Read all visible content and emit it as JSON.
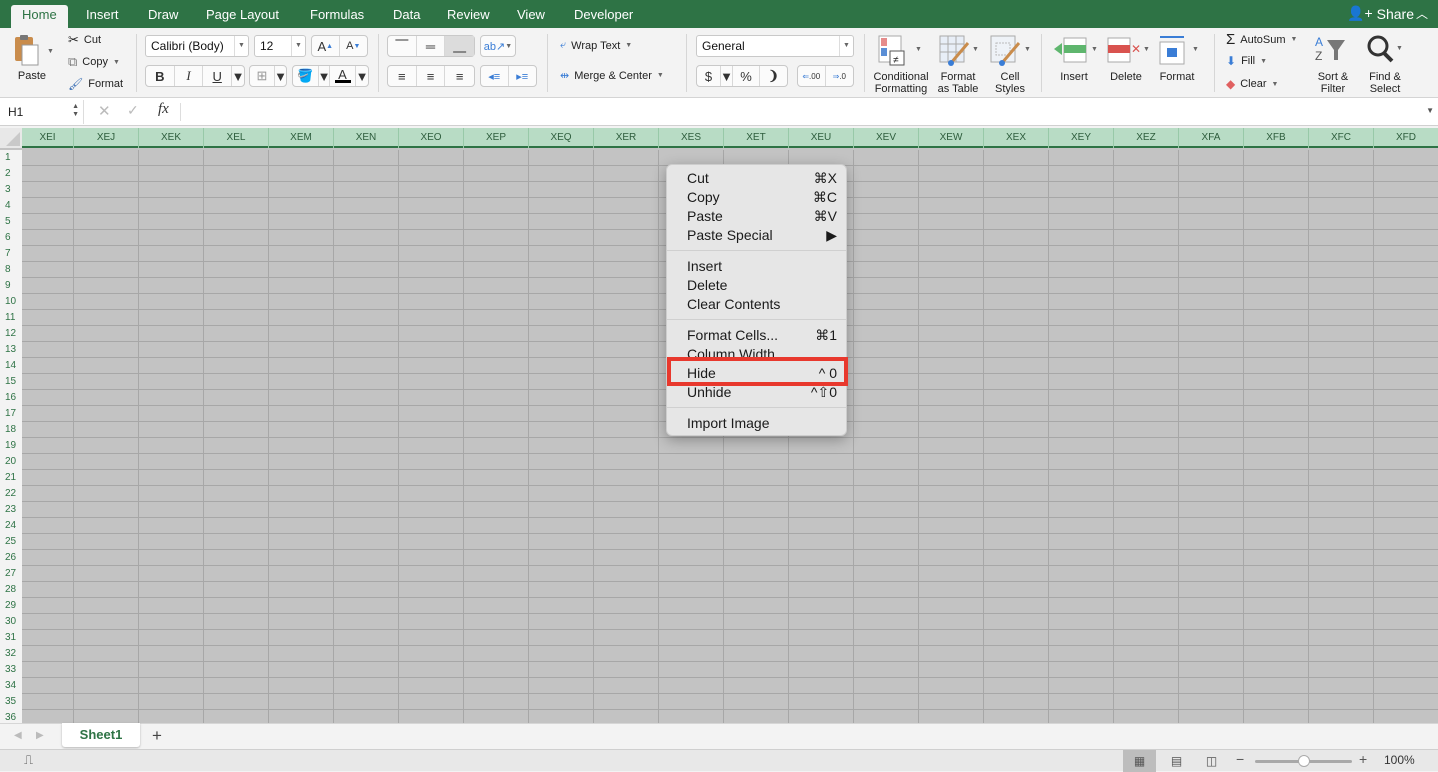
{
  "ribbon_tabs": [
    "Home",
    "Insert",
    "Draw",
    "Page Layout",
    "Formulas",
    "Data",
    "Review",
    "View",
    "Developer"
  ],
  "active_tab": "Home",
  "share_label": "Share",
  "clipboard": {
    "paste": "Paste",
    "cut": "Cut",
    "copy": "Copy",
    "format": "Format"
  },
  "font": {
    "name": "Calibri (Body)",
    "size": "12",
    "bold": "B",
    "italic": "I",
    "underline": "U"
  },
  "alignment": {
    "wrap_text": "Wrap Text",
    "merge_center": "Merge & Center"
  },
  "number": {
    "format": "General",
    "currency": "$",
    "percent": "%",
    "comma": "❩",
    "inc_decimal": ".00",
    "dec_decimal": ".0"
  },
  "styles": {
    "conditional": [
      "Conditional",
      "Formatting"
    ],
    "format_table": [
      "Format",
      "as Table"
    ],
    "cell_styles": [
      "Cell",
      "Styles"
    ]
  },
  "cells": {
    "insert": "Insert",
    "delete": "Delete",
    "format": "Format"
  },
  "editing": {
    "autosum": "AutoSum",
    "fill": "Fill",
    "clear": "Clear",
    "sort_filter": [
      "Sort &",
      "Filter"
    ],
    "find_select": [
      "Find &",
      "Select"
    ]
  },
  "formula_bar": {
    "name_box": "H1",
    "fx": "fx",
    "value": ""
  },
  "columns": [
    "XEI",
    "XEJ",
    "XEK",
    "XEL",
    "XEM",
    "XEN",
    "XEO",
    "XEP",
    "XEQ",
    "XER",
    "XES",
    "XET",
    "XEU",
    "XEV",
    "XEW",
    "XEX",
    "XEY",
    "XEZ",
    "XFA",
    "XFB",
    "XFC",
    "XFD"
  ],
  "rows": [
    "1",
    "2",
    "3",
    "4",
    "5",
    "6",
    "7",
    "8",
    "9",
    "10",
    "11",
    "12",
    "13",
    "14",
    "15",
    "16",
    "17",
    "18",
    "19",
    "20",
    "21",
    "22",
    "23",
    "24",
    "25",
    "26",
    "27",
    "28",
    "29",
    "30",
    "31",
    "32",
    "33",
    "34",
    "35",
    "36"
  ],
  "context_menu": {
    "groups": [
      [
        {
          "label": "Cut",
          "shortcut": "⌘X"
        },
        {
          "label": "Copy",
          "shortcut": "⌘C"
        },
        {
          "label": "Paste",
          "shortcut": "⌘V"
        },
        {
          "label": "Paste Special",
          "shortcut": "▶"
        }
      ],
      [
        {
          "label": "Insert",
          "shortcut": ""
        },
        {
          "label": "Delete",
          "shortcut": ""
        },
        {
          "label": "Clear Contents",
          "shortcut": ""
        }
      ],
      [
        {
          "label": "Format Cells...",
          "shortcut": "⌘1"
        },
        {
          "label": "Column Width...",
          "shortcut": ""
        },
        {
          "label": "Hide",
          "shortcut": "^ 0"
        },
        {
          "label": "Unhide",
          "shortcut": "^⇧0"
        }
      ],
      [
        {
          "label": "Import Image",
          "shortcut": ""
        }
      ]
    ],
    "highlighted": "Hide",
    "highlight_color": "#e8382d"
  },
  "sheets": [
    "Sheet1"
  ],
  "status": {
    "zoom": "100%",
    "zoom_level": 0.5
  },
  "colors": {
    "brand_green": "#2e7345",
    "header_green": "#b8dcc5",
    "selection_gray": "#c3c3c3"
  }
}
